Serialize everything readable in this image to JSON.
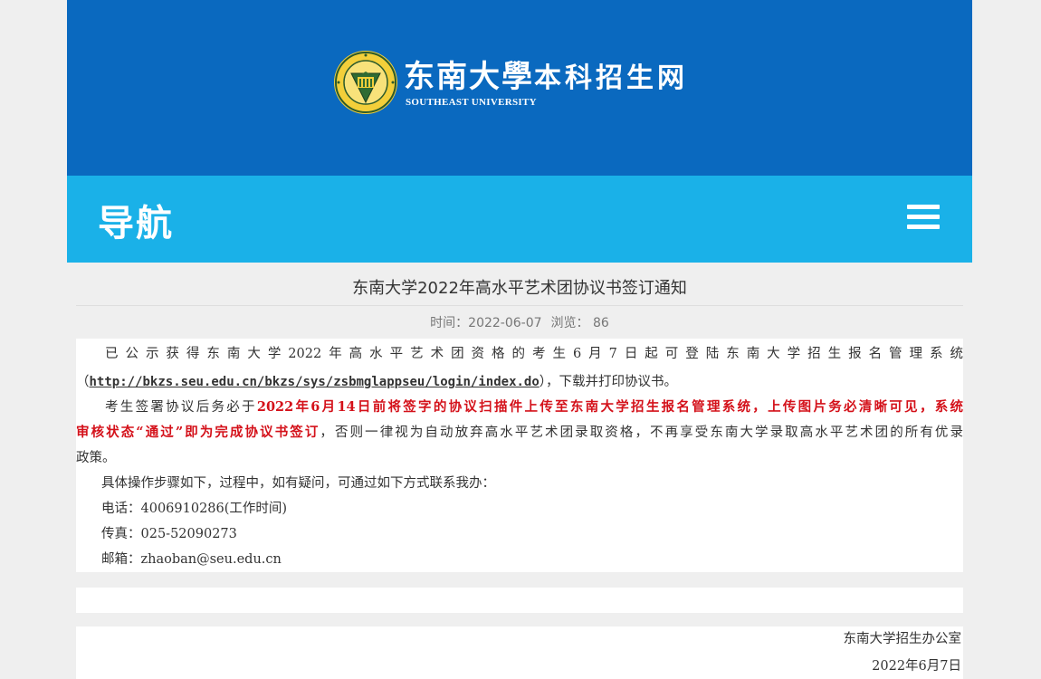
{
  "header": {
    "logo_cn": "东南大學",
    "logo_subtitle": "本科招生网",
    "logo_en": "SOUTHEAST UNIVERSITY",
    "seal_icon": "university-seal-icon"
  },
  "nav": {
    "title": "导航",
    "menu_icon": "hamburger-menu-icon"
  },
  "article": {
    "title": "东南大学2022年高水平艺术团协议书签订通知",
    "time_label": "时间：",
    "time_value": "2022-06-07",
    "views_label": "浏览：",
    "views_value": "86",
    "p1_line1": "已公示获得东南大学2022年高水平艺术团资格的考生6月7日起可登陆东南大学招生报名管理系统",
    "p1_open": "（",
    "p1_link": "http://bkzs.seu.edu.cn/bkzs/sys/zsbmglappseu/login/index.do",
    "p1_close": "），下载并打印协议书。",
    "p2_prefix": "考生签署协议后务必于",
    "p2_red_a": "2022年6月14日前将签字的协议扫描件上传至东南大学招生报名管理系统，上传图片务必清晰可见，系统",
    "p2_red_b": "审核状态“通过”即为完成协议书签订",
    "p2_suffix": "，否则一律视为自动放弃高水平艺术团录取资格，不再享受东南大学录取高水平艺术团的所有优录",
    "p2_end": "政策。",
    "p3": "具体操作步骤如下，过程中，如有疑问，可通过如下方式联系我办：",
    "phone": "电话：4006910286(工作时间)",
    "fax": "传真：025-52090273",
    "email": "邮箱：zhaoban@seu.edu.cn",
    "signature_org": "东南大学招生办公室",
    "signature_date": "2022年6月7日"
  },
  "colors": {
    "banner": "#0a69bf",
    "navbar": "#1ab1e8",
    "highlight_red": "#d4111a"
  }
}
